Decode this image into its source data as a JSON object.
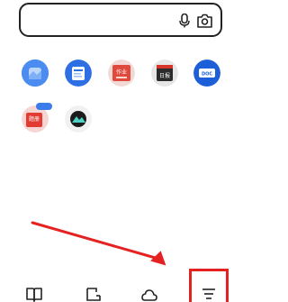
{
  "search": {
    "mic_icon": "microphone-icon",
    "camera_icon": "camera-icon"
  },
  "apps_row1": [
    {
      "label": "",
      "icon": "cloud-drive-icon"
    },
    {
      "label": "",
      "icon": "document-scan-icon"
    },
    {
      "label": "",
      "icon": "homework-icon"
    },
    {
      "label": "",
      "icon": "daily-news-icon"
    },
    {
      "label": "",
      "icon": "doc-icon"
    }
  ],
  "apps_row2": [
    {
      "label": "",
      "icon": "study-icon",
      "badge": ""
    },
    {
      "label": "",
      "icon": "mountain-icon"
    }
  ],
  "tile_texts": {
    "homework": "作业",
    "daily": "日报",
    "doc": "DOC",
    "study": "题册"
  },
  "bottom_nav": [
    {
      "name": "book-icon"
    },
    {
      "name": "crop-icon"
    },
    {
      "name": "cloud-icon"
    },
    {
      "name": "menu-icon"
    }
  ],
  "colors": {
    "accent_red": "#e52222",
    "blue": "#3b7bea",
    "dark_blue": "#1d5fd8"
  }
}
